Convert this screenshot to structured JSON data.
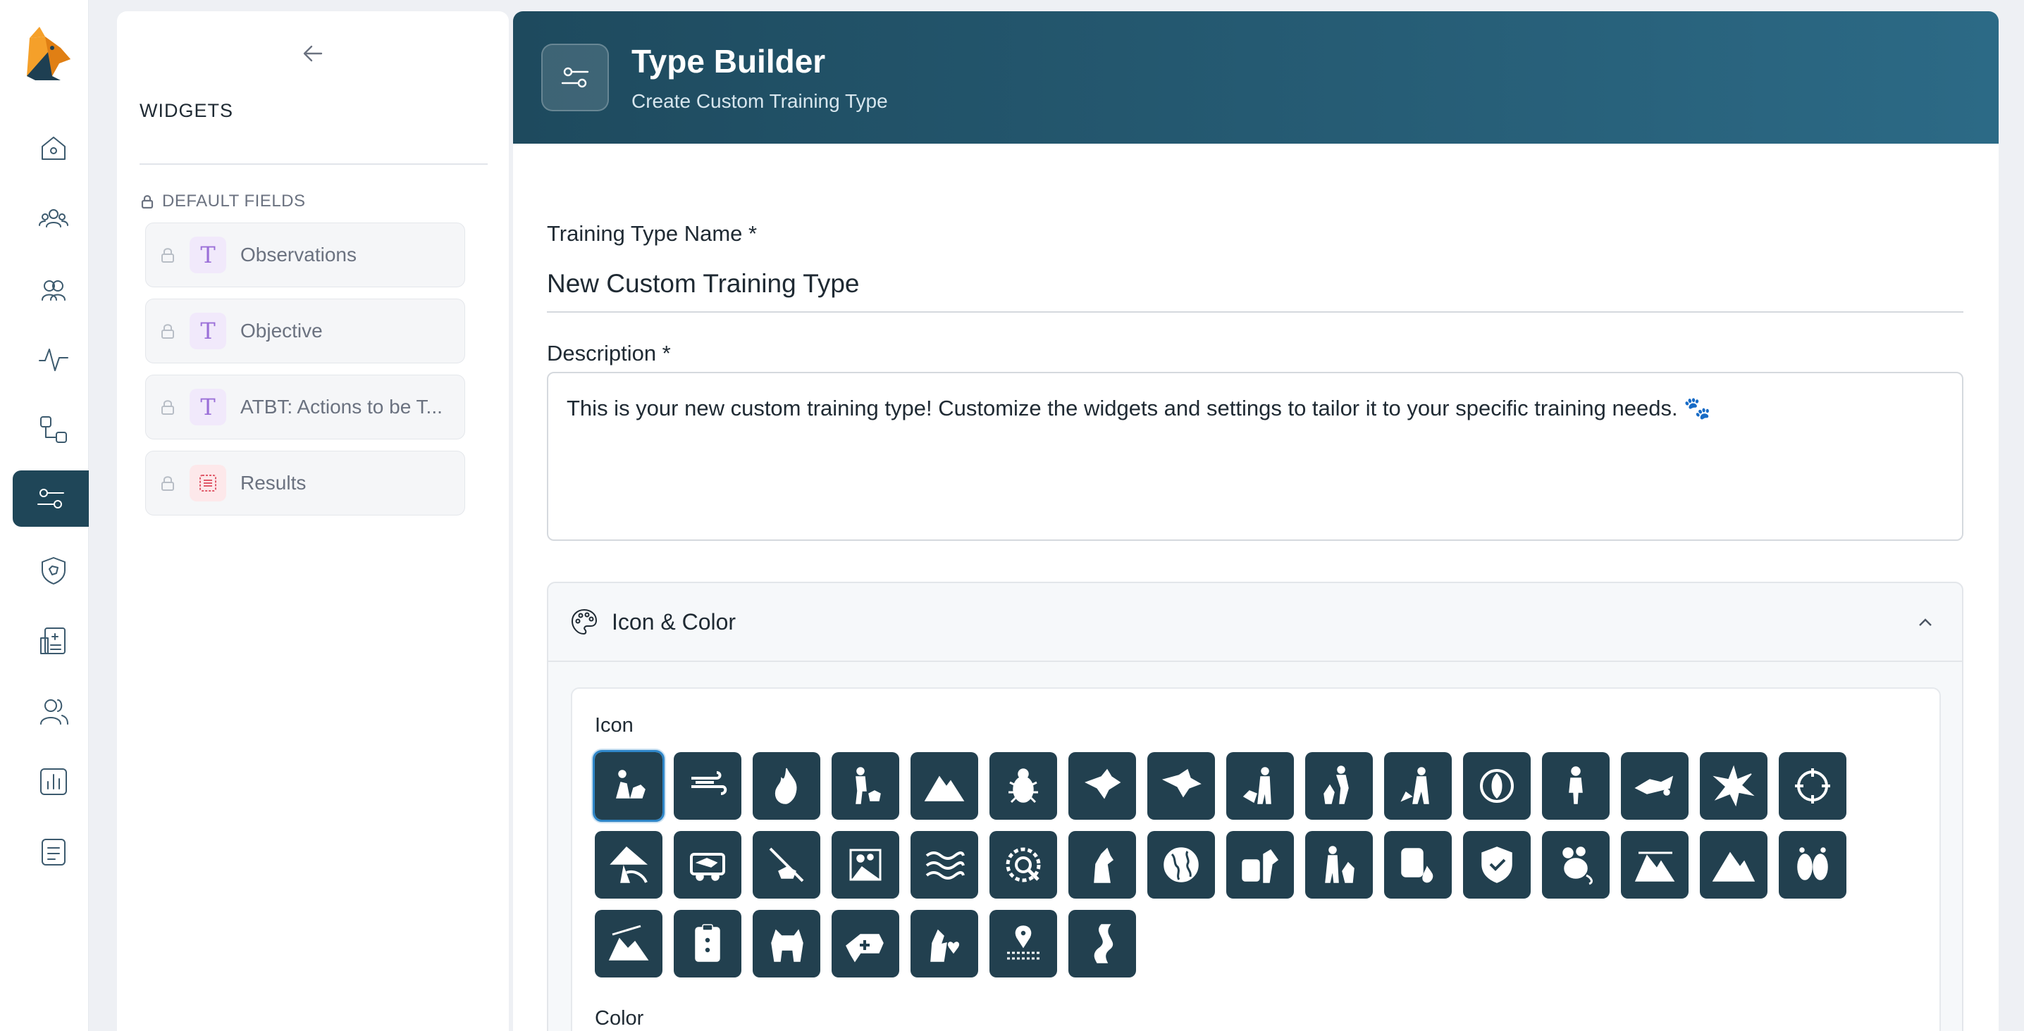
{
  "app": {
    "logo_name": "dog-logo"
  },
  "nav": {
    "items": [
      {
        "icon": "home-icon",
        "active": false
      },
      {
        "icon": "team-icon",
        "active": false
      },
      {
        "icon": "groups-icon",
        "active": false
      },
      {
        "icon": "activity-icon",
        "active": false
      },
      {
        "icon": "workflow-icon",
        "active": false
      },
      {
        "icon": "type-builder-icon",
        "active": true
      },
      {
        "icon": "shield-icon",
        "active": false
      },
      {
        "icon": "medical-record-icon",
        "active": false
      },
      {
        "icon": "users-icon",
        "active": false
      },
      {
        "icon": "reports-icon",
        "active": false
      },
      {
        "icon": "documents-icon",
        "active": false
      }
    ]
  },
  "widgets": {
    "title": "WIDGETS",
    "section_label": "DEFAULT FIELDS",
    "fields": [
      {
        "label": "Observations",
        "type": "text"
      },
      {
        "label": "Objective",
        "type": "text"
      },
      {
        "label": "ATBT: Actions to be T...",
        "type": "text"
      },
      {
        "label": "Results",
        "type": "results"
      }
    ]
  },
  "header": {
    "title": "Type Builder",
    "subtitle": "Create Custom Training Type"
  },
  "form": {
    "name_label": "Training Type Name *",
    "name_value": "New Custom Training Type",
    "description_label": "Description *",
    "description_value": "This is your new custom training type! Customize the widgets and settings to tailor it to your specific training needs. 🐾"
  },
  "icon_color": {
    "section_title": "Icon & Color",
    "icon_label": "Icon",
    "color_label": "Color",
    "selected_index": 0,
    "icons": [
      "dog-handler-icon",
      "wind-icon",
      "fire-icon",
      "handler-kneel-icon",
      "avalanche-icon",
      "bug-icon",
      "dog-head-icon",
      "dog-head-alt-icon",
      "handler-walk-icon",
      "handler-jump-icon",
      "handler-search-icon",
      "cycle-icon",
      "person-standing-icon",
      "dog-jump-icon",
      "explosion-icon",
      "crosshair-icon",
      "tree-mountain-icon",
      "vehicle-icon",
      "dog-sniff-icon",
      "rubble-icon",
      "water-waves-icon",
      "gear-search-icon",
      "dog-sit-icon",
      "globe-icon",
      "luggage-dog-icon",
      "person-dog-icon",
      "barrel-icon",
      "shield-check-icon",
      "rat-icon",
      "terrain-icon",
      "mountain-slide-icon",
      "footprints-icon",
      "landslide-icon",
      "clipboard-icon",
      "dog-stand-icon",
      "dog-medical-icon",
      "dog-heart-icon",
      "location-trail-icon",
      "river-icon"
    ]
  }
}
